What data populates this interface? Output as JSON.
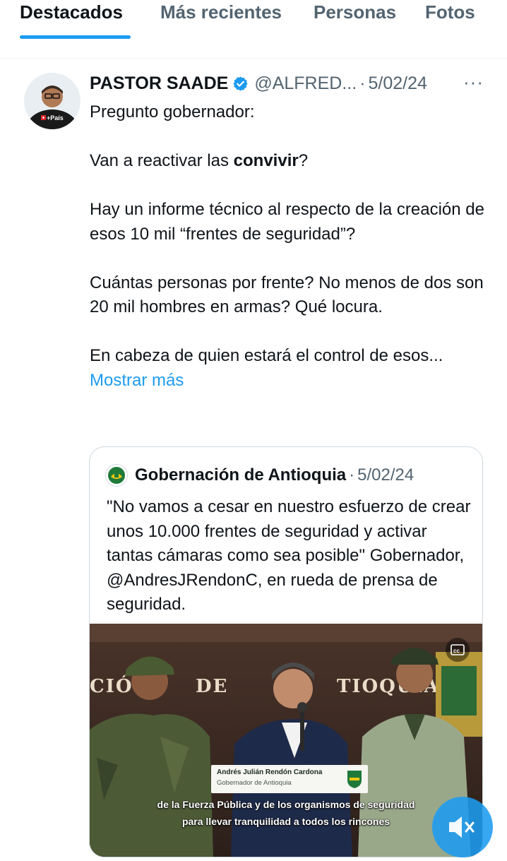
{
  "tabs": [
    {
      "label": "Destacados",
      "active": true
    },
    {
      "label": "Más recientes",
      "active": false
    },
    {
      "label": "Personas",
      "active": false
    },
    {
      "label": "Fotos",
      "active": false
    }
  ],
  "tweet": {
    "author_name": "PASTOR SAADE",
    "handle": "@ALFRED...",
    "separator": "·",
    "date": "5/02/24",
    "more_icon": "more-horizontal-icon",
    "avatar_badge": "+País",
    "lines": {
      "p1": "Pregunto gobernador:",
      "p2_pre": "Van a reactivar las ",
      "p2_bold": "convivir",
      "p2_post": "?",
      "p3": "Hay un informe técnico al respecto de la creación de esos 10 mil “frentes de seguridad”?",
      "p4": "Cuántas personas por frente? No menos de dos son 20 mil hombres en armas? Qué locura.",
      "p5": "En cabeza de quien estará el control de esos... ",
      "show_more": "Mostrar más"
    }
  },
  "quote": {
    "author_name": "Gobernación de Antioquia",
    "separator": "·",
    "date": "5/02/24",
    "text": "\"No vamos a cesar en nuestro esfuerzo de crear unos 10.000 frentes de seguridad y activar tantas cámaras como sea posible\" Gobernador, @AndresJRendonC, en rueda de prensa de seguridad.",
    "video": {
      "lower_third_name": "Andrés Julián Rendón Cardona",
      "lower_third_title": "Gobernador de Antioquia",
      "caption_line1": "de la Fuerza Pública y de los organismos de seguridad",
      "caption_line2": "para llevar tranquilidad a todos los rincones",
      "wall_letters_left": "CIÓ",
      "wall_letters_mid": "DE",
      "wall_letters_right": "TIOQUIA",
      "cc_icon": "closed-captions-icon",
      "mute_icon": "speaker-muted-icon"
    }
  },
  "colors": {
    "accent": "#1d9bf0",
    "text_primary": "#0f1419",
    "text_secondary": "#536471",
    "border": "#cfd9de"
  }
}
